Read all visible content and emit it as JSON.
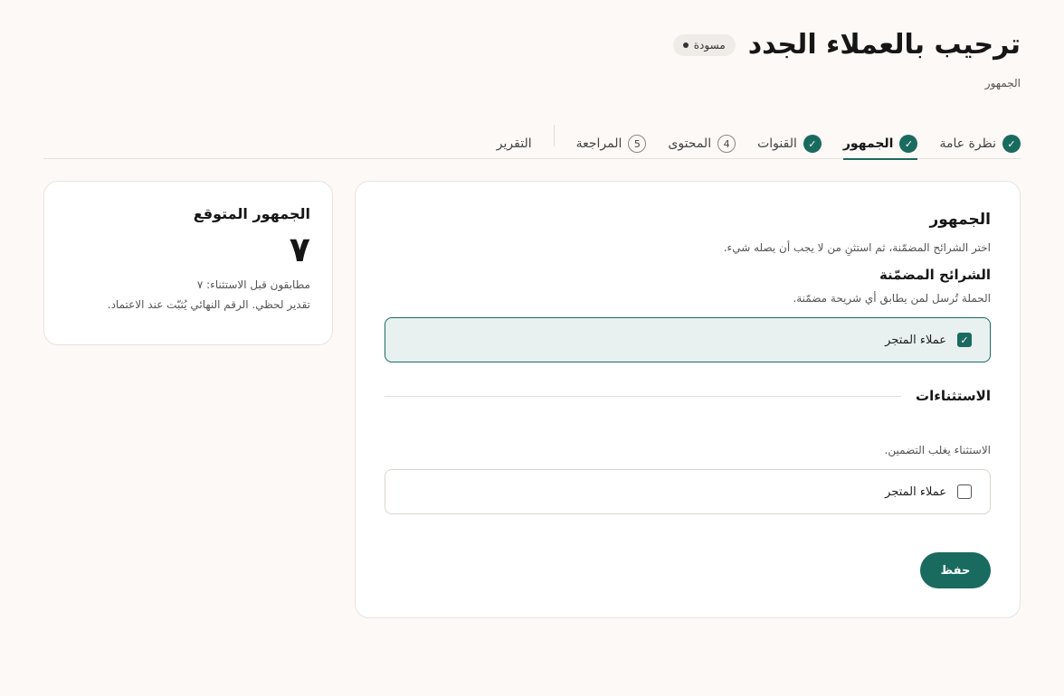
{
  "header": {
    "title": "ترحيب بالعملاء الجدد",
    "status": "مسودة",
    "breadcrumb": "الجمهور"
  },
  "tabs": [
    {
      "label": "نظرة عامة",
      "state": "done"
    },
    {
      "label": "الجمهور",
      "state": "active"
    },
    {
      "label": "القنوات",
      "state": "done"
    },
    {
      "label": "المحتوى",
      "state": "number",
      "number": "4"
    },
    {
      "label": "المراجعة",
      "state": "number",
      "number": "5"
    },
    {
      "label": "التقرير",
      "state": "plain"
    }
  ],
  "icons": {
    "check": "check-icon"
  },
  "main": {
    "title": "الجمهور",
    "description": "اختر الشرائح المضمّنة، ثم استثنِ من لا يجب أن يصله شيء.",
    "included": {
      "title": "الشرائح المضمّنة",
      "description": "الحملة تُرسل لمن يطابق أي شريحة مضمّنة.",
      "option_label": "عملاء المتجر",
      "checked": true
    },
    "exclusions": {
      "title": "الاستثناءات",
      "description": "الاستثناء يغلب التضمين.",
      "option_label": "عملاء المتجر",
      "checked": false
    },
    "save_label": "حفظ"
  },
  "side": {
    "title": "الجمهور المتوقع",
    "count": "٧",
    "matched_before_exclusion": "مطابقون قبل الاستثناء: ٧",
    "note": "تقدير لحظي. الرقم النهائي يُثبّت عند الاعتماد."
  },
  "colors": {
    "accent": "#1a6b5f",
    "background": "#fdf9f6",
    "selected_bg": "#e8f1ef"
  }
}
